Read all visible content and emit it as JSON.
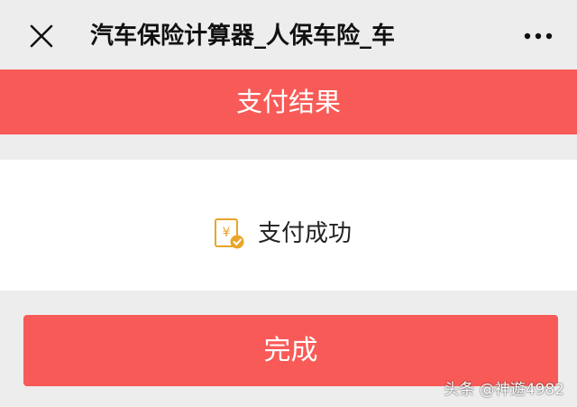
{
  "navbar": {
    "title": "汽车保险计算器_人保车险_车",
    "close_icon": "close-icon",
    "more_icon": "more-dots-icon"
  },
  "header": {
    "title": "支付结果"
  },
  "result": {
    "status_text": "支付成功",
    "status_icon": "yuan-receipt-check-icon"
  },
  "actions": {
    "done_label": "完成"
  },
  "watermark": {
    "text": "头条 @神遊4982"
  },
  "colors": {
    "accent": "#f85b57",
    "background": "#ededed",
    "icon_gold": "#e9a52a"
  }
}
